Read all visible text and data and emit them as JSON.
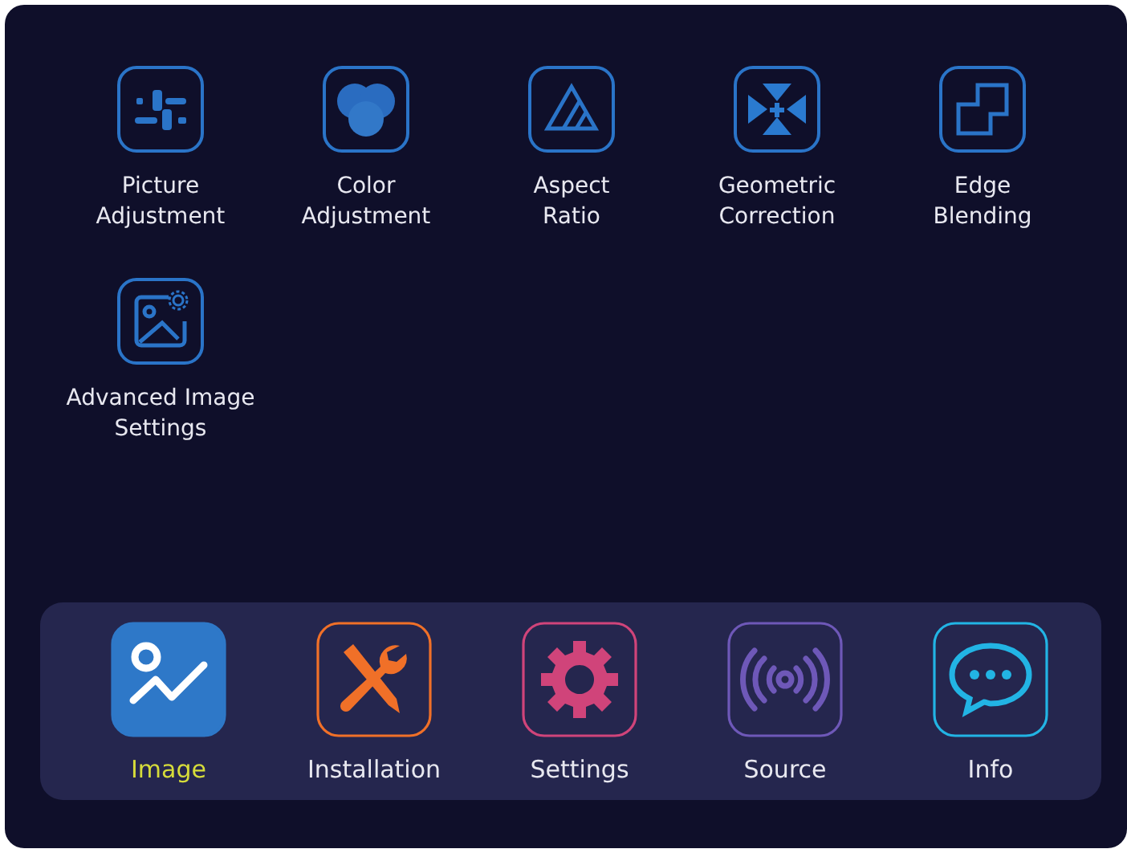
{
  "menu_items": [
    {
      "label": "Picture\nAdjustment",
      "kind": "sliders"
    },
    {
      "label": "Color\nAdjustment",
      "kind": "circles"
    },
    {
      "label": "Aspect\nRatio",
      "kind": "triangle"
    },
    {
      "label": "Geometric\nCorrection",
      "kind": "arrows"
    },
    {
      "label": "Edge\nBlending",
      "kind": "blend"
    },
    {
      "label": "Advanced Image\nSettings",
      "kind": "image"
    }
  ],
  "dock": [
    {
      "label": "Image",
      "kind": "chart",
      "color": "#2e78c8",
      "selected": true
    },
    {
      "label": "Installation",
      "kind": "tools",
      "color": "#f07028",
      "selected": false
    },
    {
      "label": "Settings",
      "kind": "gear",
      "color": "#d0447a",
      "selected": false
    },
    {
      "label": "Source",
      "kind": "signal",
      "color": "#6e58b8",
      "selected": false
    },
    {
      "label": "Info",
      "kind": "chat",
      "color": "#22b4e4",
      "selected": false
    }
  ]
}
